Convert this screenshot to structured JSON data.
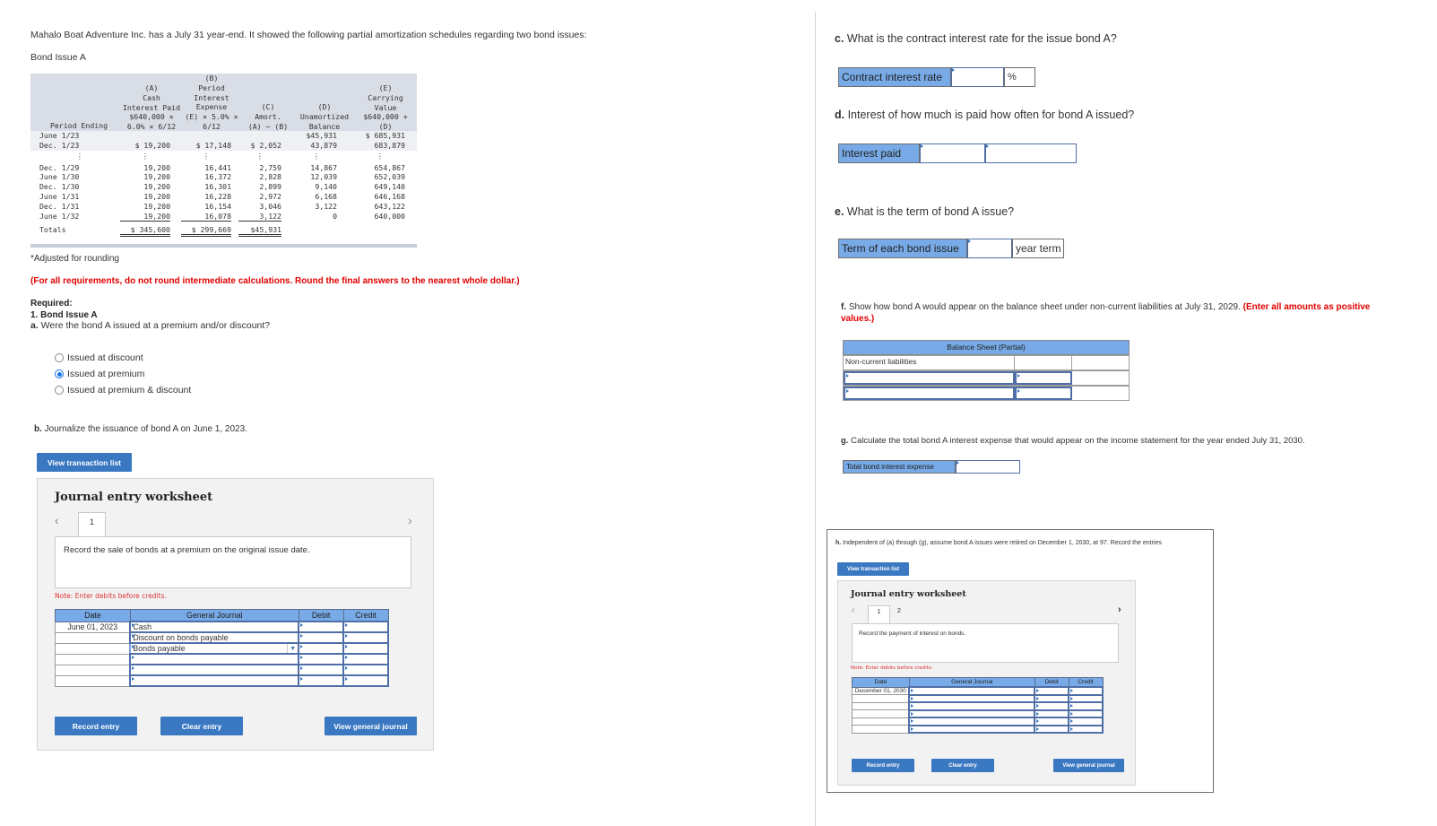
{
  "intro": "Mahalo Boat Adventure Inc. has a July 31 year-end. It showed the following partial amortization schedules regarding two bond issues:",
  "bond_header": "Bond Issue A",
  "amort_table": {
    "headers": {
      "period": "Period Ending",
      "a": "(A)\nCash\nInterest Paid\n$640,000 ×\n6.0% × 6/12",
      "b": "(B)\nPeriod\nInterest\nExpense\n(E) × 5.0% ×\n6/12",
      "c": "(C)\nAmort.\n(A) − (B)",
      "d": "(D)\nUnamortized\nBalance",
      "e": "(E)\nCarrying\nValue\n$640,000 +\n(D)"
    },
    "rows": [
      {
        "period": "June 1/23",
        "a": "",
        "b": "",
        "c": "",
        "d": "$45,931",
        "e": "$ 685,931"
      },
      {
        "period": "Dec. 1/23",
        "a": "$   19,200",
        "b": "$   17,148",
        "c": "$ 2,052",
        "d": "43,879",
        "e": "683,879"
      },
      {
        "period": "⋮",
        "a": "⋮",
        "b": "⋮",
        "c": "⋮",
        "d": "⋮",
        "e": "⋮"
      },
      {
        "period": "Dec. 1/29",
        "a": "19,200",
        "b": "16,441",
        "c": "2,759",
        "d": "14,867",
        "e": "654,867"
      },
      {
        "period": "June 1/30",
        "a": "19,200",
        "b": "16,372",
        "c": "2,828",
        "d": "12,039",
        "e": "652,039"
      },
      {
        "period": "Dec. 1/30",
        "a": "19,200",
        "b": "16,301",
        "c": "2,899",
        "d": "9,140",
        "e": "649,140"
      },
      {
        "period": "June 1/31",
        "a": "19,200",
        "b": "16,228",
        "c": "2,972",
        "d": "6,168",
        "e": "646,168"
      },
      {
        "period": "Dec. 1/31",
        "a": "19,200",
        "b": "16,154",
        "c": "3,046",
        "d": "3,122",
        "e": "643,122"
      },
      {
        "period": "June 1/32",
        "a": "19,200",
        "b": "16,078",
        "c": "3,122",
        "d": "0",
        "e": "640,000"
      }
    ],
    "totals": {
      "label": "Totals",
      "a": "$ 345,600",
      "b": "$ 299,669",
      "c": "$45,931"
    }
  },
  "footnote": "*Adjusted for rounding",
  "instruction": "(For all requirements, do not round intermediate calculations. Round the final answers to the nearest whole dollar.)",
  "required": {
    "label": "Required:",
    "section": "1. Bond Issue A"
  },
  "qa": {
    "letter": "a.",
    "text": " Were the bond A issued at a premium and/or discount?",
    "options": [
      {
        "label": "Issued at discount",
        "selected": false
      },
      {
        "label": "Issued at premium",
        "selected": true
      },
      {
        "label": "Issued at premium & discount",
        "selected": false
      }
    ]
  },
  "qb": {
    "letter": "b.",
    "text": " Journalize the issuance of bond A on June 1, 2023.",
    "view_transaction_list": "View transaction list",
    "worksheet": {
      "title": "Journal entry worksheet",
      "tabs": [
        "1"
      ],
      "description": "Record the sale of bonds at a premium on the original issue date.",
      "note": "Note: Enter debits before credits.",
      "columns": [
        "Date",
        "General Journal",
        "Debit",
        "Credit"
      ],
      "rows": [
        {
          "date": "June 01, 2023",
          "account": "Cash",
          "debit": "",
          "credit": ""
        },
        {
          "date": "",
          "account": "Discount on bonds payable",
          "debit": "",
          "credit": ""
        },
        {
          "date": "",
          "account": "Bonds payable",
          "debit": "",
          "credit": ""
        },
        {
          "date": "",
          "account": "",
          "debit": "",
          "credit": ""
        },
        {
          "date": "",
          "account": "",
          "debit": "",
          "credit": ""
        },
        {
          "date": "",
          "account": "",
          "debit": "",
          "credit": ""
        }
      ],
      "buttons": {
        "record": "Record entry",
        "clear": "Clear entry",
        "view_journal": "View general journal"
      }
    }
  },
  "qc": {
    "letter": "c.",
    "text": " What is the contract interest rate for the issue bond A?",
    "label": "Contract interest rate",
    "value": "",
    "unit": "%"
  },
  "qd": {
    "letter": "d.",
    "text": " Interest of how much is paid how often for bond A issued?",
    "label": "Interest paid",
    "value1": "",
    "value2": ""
  },
  "qe": {
    "letter": "e.",
    "text": " What is the term of bond A issue?",
    "label": "Term of each bond issue",
    "value": "",
    "unit": "year term"
  },
  "qf": {
    "letter": "f.",
    "text": " Show how bond A would appear on the balance sheet under non-current liabilities at July 31, 2029.",
    "instruction": "(Enter all amounts as positive values.)",
    "table_title": "Balance Sheet (Partial)",
    "row_label": "Non-current liabilities"
  },
  "qg": {
    "letter": "g.",
    "text": " Calculate the total bond A interest expense that would appear on the income statement for the year ended July 31, 2030.",
    "label": "Total bond interest expense",
    "value": ""
  },
  "qh": {
    "letter": "h.",
    "text": " Independent of (a) through (g), assume bond A issues were retired on December 1, 2030, at 97. Record the entries",
    "view_transaction_list": "View transaction list",
    "worksheet": {
      "title": "Journal entry worksheet",
      "tabs": [
        "1",
        "2"
      ],
      "description": "Record the payment of interest on bonds.",
      "note": "Note: Enter debits before credits.",
      "columns": [
        "Date",
        "General Journal",
        "Debit",
        "Credit"
      ],
      "rows": [
        {
          "date": "December 01, 2030",
          "account": "",
          "debit": "",
          "credit": ""
        },
        {
          "date": "",
          "account": "",
          "debit": "",
          "credit": ""
        },
        {
          "date": "",
          "account": "",
          "debit": "",
          "credit": ""
        },
        {
          "date": "",
          "account": "",
          "debit": "",
          "credit": ""
        },
        {
          "date": "",
          "account": "",
          "debit": "",
          "credit": ""
        },
        {
          "date": "",
          "account": "",
          "debit": "",
          "credit": ""
        }
      ],
      "buttons": {
        "record": "Record entry",
        "clear": "Clear entry",
        "view_journal": "View general journal"
      }
    }
  },
  "colors": {
    "accent": "#3a78c2",
    "table_header": "#77aae6",
    "warning_red": "#e00000"
  }
}
